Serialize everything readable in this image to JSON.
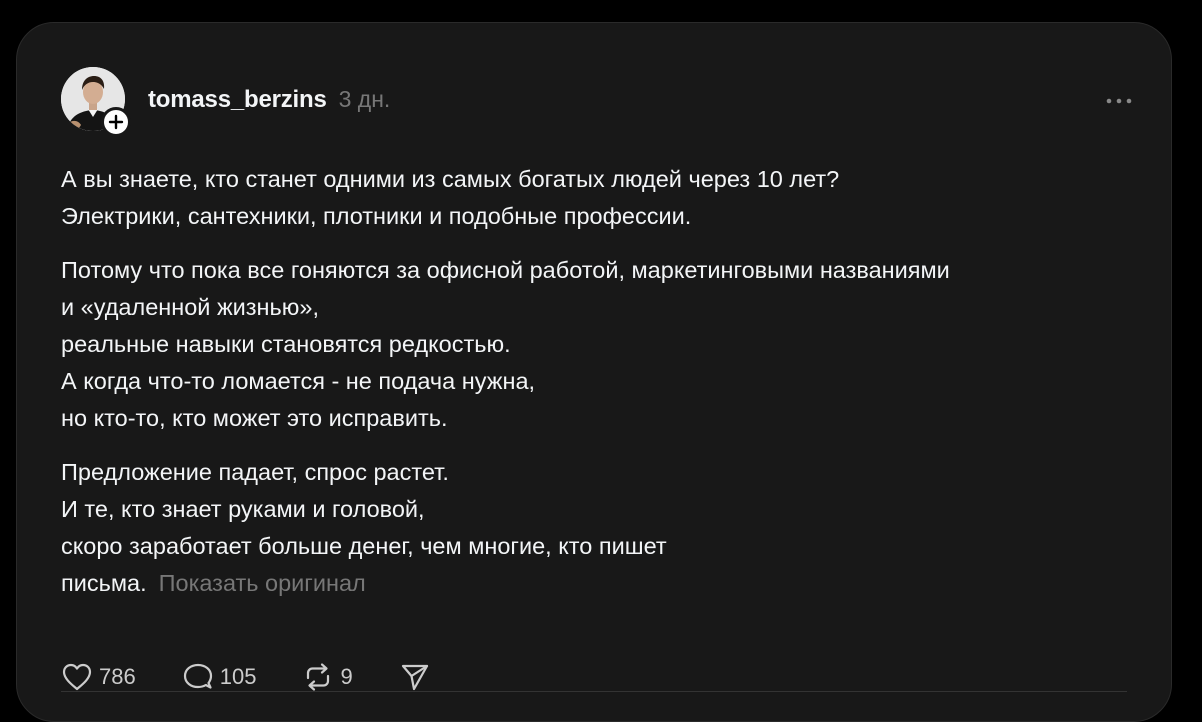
{
  "post": {
    "username": "tomass_berzins",
    "timestamp": "3 дн.",
    "paragraphs": [
      {
        "lines": [
          "А вы знаете, кто станет одними из самых богатых людей через 10 лет?",
          "Электрики, сантехники, плотники и подобные профессии."
        ]
      },
      {
        "lines": [
          "Потому что пока все гоняются за офисной работой, маркетинговыми названиями",
          "и «удаленной жизнью»,",
          "реальные навыки становятся редкостью.",
          "А когда что-то ломается - не подача нужна,",
          "но кто-то, кто может это исправить."
        ]
      },
      {
        "lines": [
          "Предложение падает, спрос растет.",
          "И те, кто знает руками и головой,",
          "скоро заработает больше денег, чем многие, кто пишет",
          "письма."
        ]
      }
    ],
    "translate_link": "Показать оригинал"
  },
  "actions": {
    "likes": "786",
    "comments": "105",
    "reposts": "9"
  },
  "icons": {
    "avatar": "profile-photo",
    "follow": "plus-icon",
    "more": "more-horizontal-icon",
    "like": "heart-icon",
    "comment": "comment-bubble-icon",
    "repost": "repost-icon",
    "share": "send-icon"
  },
  "colors": {
    "background": "#000000",
    "card": "#181818",
    "text": "#f3f5f7",
    "muted": "#777777"
  }
}
